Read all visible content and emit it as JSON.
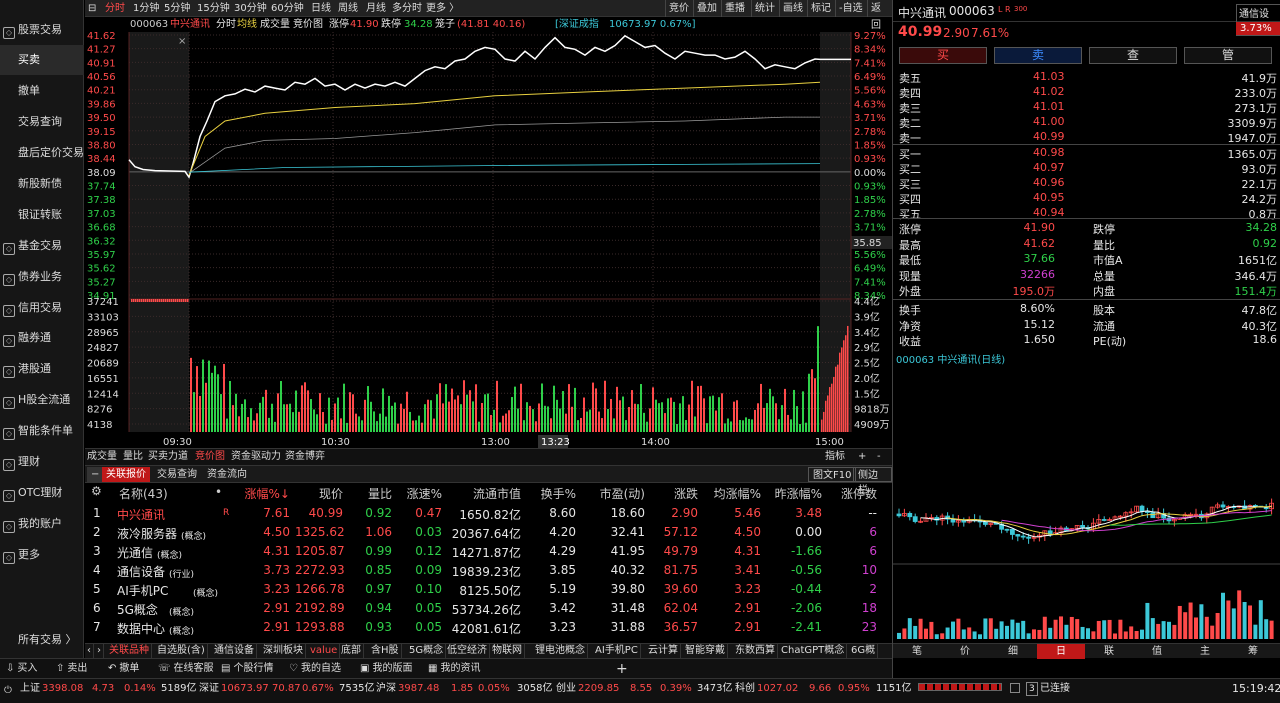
{
  "left_nav": {
    "items": [
      {
        "label": "股票交易",
        "type": "main",
        "icon": "stock-icon"
      },
      {
        "label": "买卖",
        "type": "sub",
        "active": true
      },
      {
        "label": "撤单",
        "type": "sub"
      },
      {
        "label": "交易查询",
        "type": "sub"
      },
      {
        "label": "盘后定价交易",
        "type": "sub"
      },
      {
        "label": "新股新债",
        "type": "sub"
      },
      {
        "label": "银证转账",
        "type": "sub"
      },
      {
        "label": "基金交易",
        "type": "main",
        "icon": "fund-icon"
      },
      {
        "label": "债券业务",
        "type": "main",
        "icon": "bond-icon"
      },
      {
        "label": "信用交易",
        "type": "main",
        "icon": "credit-icon"
      },
      {
        "label": "融券通",
        "type": "main",
        "icon": "lending-icon"
      },
      {
        "label": "港股通",
        "type": "main",
        "icon": "hk-icon"
      },
      {
        "label": "H股全流通",
        "type": "main",
        "icon": "h-share-icon"
      },
      {
        "label": "智能条件单",
        "type": "main",
        "icon": "smart-order-icon"
      },
      {
        "label": "理财",
        "type": "main",
        "icon": "wealth-icon"
      },
      {
        "label": "OTC理财",
        "type": "main",
        "icon": "otc-icon"
      },
      {
        "label": "我的账户",
        "type": "main",
        "icon": "account-icon"
      },
      {
        "label": "更多",
        "type": "main",
        "icon": "more-icon"
      },
      {
        "label": "所有交易 〉",
        "type": "footer"
      }
    ]
  },
  "period_tabs": [
    "分时",
    "1分钟",
    "5分钟",
    "15分钟",
    "30分钟",
    "60分钟",
    "日线",
    "周线",
    "月线",
    "多分时",
    "更多 〉"
  ],
  "period_active": "分时",
  "top_right_tabs": [
    "竞价",
    "叠加",
    "重播",
    "统计",
    "画线",
    "标记",
    "-自选",
    "返回"
  ],
  "info_bar": {
    "code": "000063",
    "name": "中兴通讯",
    "mode": "分时",
    "avg": "均线",
    "vol": "成交量",
    "auction": "竞价图",
    "limit_up_label": "涨停",
    "limit_up": "41.90",
    "limit_down_label": "跌停",
    "limit_down": "34.28",
    "lot_label": "笼子",
    "lot_range": "(41.81 40.16)",
    "index_label": "[深证成指",
    "index_value": "10673.97 0.67%]"
  },
  "chart": {
    "price_left": [
      "41.62",
      "41.27",
      "40.91",
      "40.56",
      "40.21",
      "39.86",
      "39.50",
      "39.15",
      "38.80",
      "38.44",
      "38.09",
      "37.74",
      "37.38",
      "37.03",
      "36.68",
      "36.32",
      "35.97",
      "35.62",
      "35.27",
      "34.91"
    ],
    "pct_right": [
      "9.27%",
      "8.34%",
      "7.41%",
      "6.49%",
      "5.56%",
      "4.63%",
      "3.71%",
      "2.78%",
      "1.85%",
      "0.93%",
      "0.00%",
      "0.93%",
      "1.85%",
      "2.78%",
      "3.71%",
      "4.63%",
      "5.56%",
      "6.49%",
      "7.41%",
      "8.34%"
    ],
    "cursor_price": "35.85",
    "vol_left": [
      "37241",
      "33103",
      "28965",
      "24827",
      "20689",
      "16551",
      "12414",
      "8276",
      "4138"
    ],
    "vol_right": [
      "4.4亿",
      "3.9亿",
      "3.4亿",
      "2.9亿",
      "2.5亿",
      "2.0亿",
      "1.5亿",
      "9818万",
      "4909万"
    ],
    "time_ticks": [
      "09:30",
      "10:30",
      "13:00",
      "14:00",
      "15:00"
    ],
    "cursor_time": "13:23"
  },
  "lower_tabs": [
    "成交量",
    "量比",
    "买卖力道",
    "竞价图",
    "资金驱动力",
    "资金博弈"
  ],
  "lower_tabs_active": "竞价图",
  "lower_tabs_right": [
    "指标",
    "+",
    "-"
  ],
  "list_tabs": [
    "关联报价",
    "交易查询",
    "资金流向"
  ],
  "list_tabs_active": "关联报价",
  "list_tabs_right": [
    "图文F10",
    "侧边栏"
  ],
  "table": {
    "columns": [
      "名称(43)",
      "•",
      "涨幅%↓",
      "现价",
      "量比",
      "涨速%",
      "流通市值",
      "换手%",
      "市盈(动)",
      "涨跌",
      "均涨幅%",
      "昨涨幅%",
      "涨停数"
    ],
    "rows": [
      {
        "no": "1",
        "name": "中兴通讯",
        "tag": "R",
        "chg": "7.61",
        "price": "40.99",
        "vr": "0.92",
        "speed": "0.47",
        "cap": "1650.82亿",
        "turn": "8.60",
        "pe": "18.60",
        "diff": "2.90",
        "avg": "5.46",
        "yday": "3.48",
        "lim": "--"
      },
      {
        "no": "2",
        "name": "液冷服务器",
        "tag": "(概念)",
        "chg": "4.50",
        "price": "1325.62",
        "vr": "1.06",
        "speed": "0.03",
        "cap": "20367.64亿",
        "turn": "4.20",
        "pe": "32.41",
        "diff": "57.12",
        "avg": "4.50",
        "yday": "0.00",
        "lim": "6"
      },
      {
        "no": "3",
        "name": "光通信",
        "tag": "(概念)",
        "chg": "4.31",
        "price": "1205.87",
        "vr": "0.99",
        "speed": "0.12",
        "cap": "14271.87亿",
        "turn": "4.29",
        "pe": "41.95",
        "diff": "49.79",
        "avg": "4.31",
        "yday": "-1.66",
        "lim": "6"
      },
      {
        "no": "4",
        "name": "通信设备",
        "tag": "(行业)",
        "chg": "3.73",
        "price": "2272.93",
        "vr": "0.85",
        "speed": "0.09",
        "cap": "19839.23亿",
        "turn": "3.85",
        "pe": "40.32",
        "diff": "81.75",
        "avg": "3.41",
        "yday": "-0.56",
        "lim": "10"
      },
      {
        "no": "5",
        "name": "AI手机PC",
        "tag": "(概念)",
        "chg": "3.23",
        "price": "1266.78",
        "vr": "0.97",
        "speed": "0.10",
        "cap": "8125.50亿",
        "turn": "5.19",
        "pe": "39.80",
        "diff": "39.60",
        "avg": "3.23",
        "yday": "-0.44",
        "lim": "2"
      },
      {
        "no": "6",
        "name": "5G概念",
        "tag": "(概念)",
        "chg": "2.91",
        "price": "2192.89",
        "vr": "0.94",
        "speed": "0.05",
        "cap": "53734.26亿",
        "turn": "3.42",
        "pe": "31.48",
        "diff": "62.04",
        "avg": "2.91",
        "yday": "-2.06",
        "lim": "18"
      },
      {
        "no": "7",
        "name": "数据中心",
        "tag": "(概念)",
        "chg": "2.91",
        "price": "1293.88",
        "vr": "0.93",
        "speed": "0.05",
        "cap": "42081.61亿",
        "turn": "3.23",
        "pe": "31.88",
        "diff": "36.57",
        "avg": "2.91",
        "yday": "-2.41",
        "lim": "23"
      }
    ]
  },
  "block_tabs": [
    "关联品种",
    "自选股(含)",
    "通信设备",
    "深圳板块",
    "value",
    "底部",
    "含H股",
    "5G概念",
    "低空经济",
    "物联网",
    "锂电池概念",
    "AI手机PC",
    "云计算",
    "智能穿戴",
    "东数西算",
    "ChatGPT概念",
    "6G概"
  ],
  "block_tabs_active": "关联品种",
  "actions": [
    "买入",
    "卖出",
    "撤单",
    "在线客服",
    "个股行情",
    "我的自选",
    "我的版面",
    "我的资讯"
  ],
  "status": {
    "sh_label": "上证",
    "sh_val": "3398.08",
    "sh_chg": "4.73",
    "sh_pct": "0.14%",
    "sh_amt": "5189亿",
    "sz_label": "深证",
    "sz_val": "10673.97",
    "sz_chg": "70.87",
    "sz_pct": "0.67%",
    "sz_amt": "7535亿",
    "hs_label": "沪深",
    "hs_val": "3987.48",
    "hs_chg": "1.85",
    "hs_pct": "0.05%",
    "hs_amt": "3058亿",
    "cy_label": "创业",
    "cy_val": "2209.85",
    "cy_chg": "8.55",
    "cy_pct": "0.39%",
    "cy_amt": "3473亿",
    "kc_label": "科创",
    "kc_val": "1027.02",
    "kc_chg": "9.66",
    "kc_pct": "0.95%",
    "kc_amt": "1151亿",
    "conn": "已连接",
    "conn_num": "3",
    "time": "15:19:42"
  },
  "quote": {
    "name": "中兴通讯",
    "code": "000063",
    "flags": "L R",
    "flags_sup": "300",
    "settings": "通信设置",
    "settings_pct": "3.73%",
    "price": "40.99",
    "chg": "2.90",
    "pct": "7.61%",
    "buttons": [
      "买",
      "卖",
      "查",
      "管"
    ],
    "asks": [
      {
        "l": "卖五",
        "p": "41.03",
        "v": "41.9万"
      },
      {
        "l": "卖四",
        "p": "41.02",
        "v": "233.0万"
      },
      {
        "l": "卖三",
        "p": "41.01",
        "v": "273.1万"
      },
      {
        "l": "卖二",
        "p": "41.00",
        "v": "3309.9万"
      },
      {
        "l": "卖一",
        "p": "40.99",
        "v": "1947.0万"
      }
    ],
    "bids": [
      {
        "l": "买一",
        "p": "40.98",
        "v": "1365.0万"
      },
      {
        "l": "买二",
        "p": "40.97",
        "v": "93.0万"
      },
      {
        "l": "买三",
        "p": "40.96",
        "v": "22.1万"
      },
      {
        "l": "买四",
        "p": "40.95",
        "v": "24.2万"
      },
      {
        "l": "买五",
        "p": "40.94",
        "v": "0.8万"
      }
    ],
    "stats": [
      {
        "l1": "涨停",
        "v1": "41.90",
        "c1": "up",
        "l2": "跌停",
        "v2": "34.28",
        "c2": "dn"
      },
      {
        "l1": "最高",
        "v1": "41.62",
        "c1": "up",
        "l2": "量比",
        "v2": "0.92",
        "c2": "dn"
      },
      {
        "l1": "最低",
        "v1": "37.66",
        "c1": "dn",
        "l2": "市值A",
        "v2": "1651亿",
        "c2": "wh"
      },
      {
        "l1": "现量",
        "v1": "32266",
        "c1": "pu",
        "l2": "总量",
        "v2": "346.4万",
        "c2": "wh"
      },
      {
        "l1": "外盘",
        "v1": "195.0万",
        "c1": "up",
        "l2": "内盘",
        "v2": "151.4万",
        "c2": "dn"
      }
    ],
    "stats2": [
      {
        "l1": "换手",
        "v1": "8.60%",
        "l2": "股本",
        "v2": "47.8亿"
      },
      {
        "l1": "净资",
        "v1": "15.12",
        "l2": "流通",
        "v2": "40.3亿"
      },
      {
        "l1": "收益",
        "v1": "1.650",
        "l2": "PE(动)",
        "v2": "18.6"
      }
    ],
    "kline_title": "000063 中兴通讯(日线)"
  },
  "right_tabs": [
    "笔",
    "价",
    "细",
    "日",
    "联",
    "值",
    "主",
    "筹"
  ],
  "right_tabs_active": "日",
  "colors": {
    "up": "#ff4a4a",
    "down": "#2fd04a",
    "price_line": "#ffffff",
    "avg_line": "#e8d040"
  }
}
